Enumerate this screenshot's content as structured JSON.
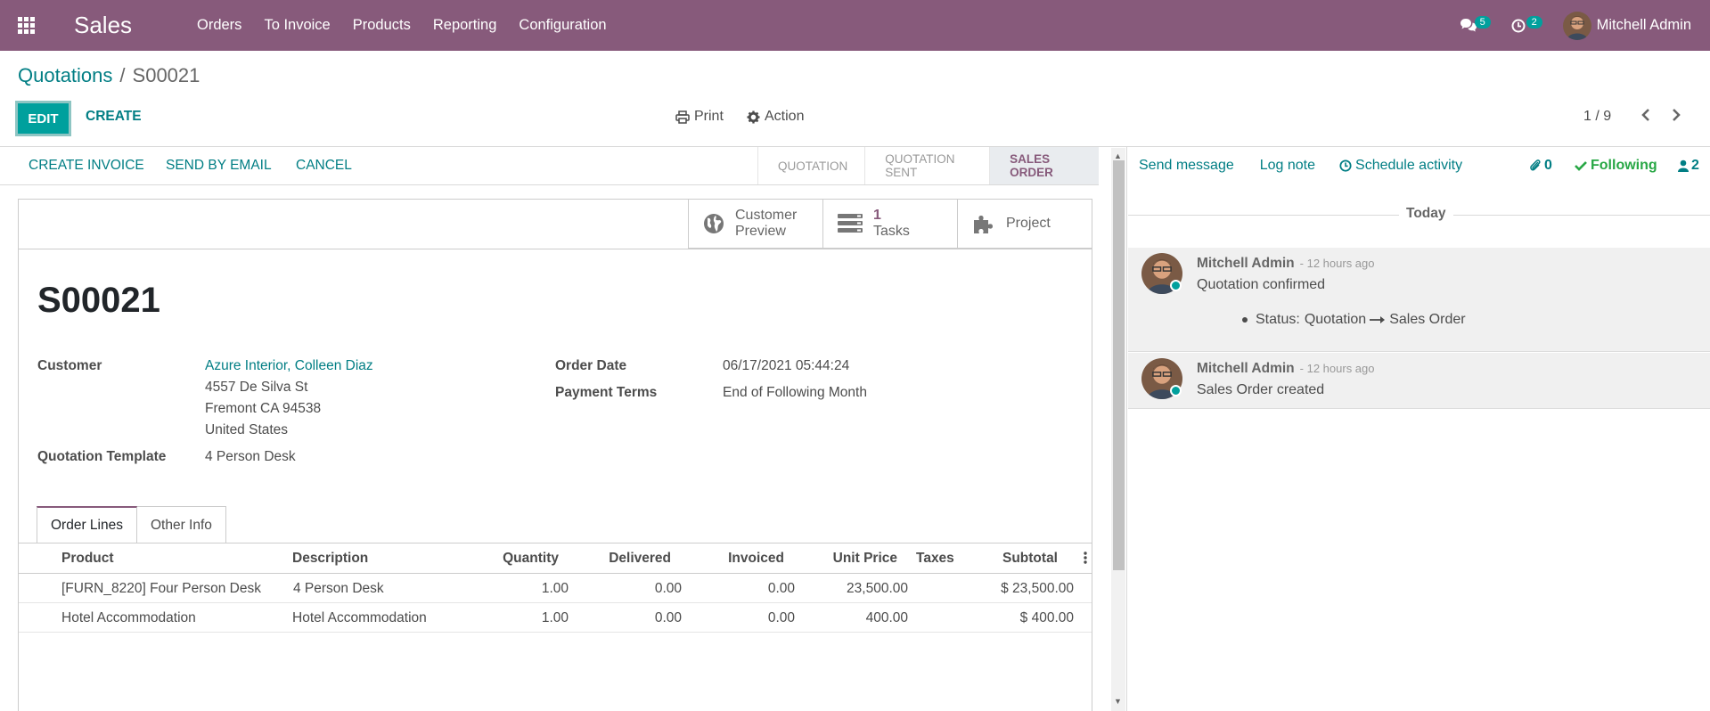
{
  "navbar": {
    "app_title": "Sales",
    "menu": [
      "Orders",
      "To Invoice",
      "Products",
      "Reporting",
      "Configuration"
    ],
    "messages_count": "5",
    "activities_count": "2",
    "user_name": "Mitchell Admin"
  },
  "breadcrumb": {
    "parent": "Quotations",
    "separator": "/",
    "current": "S00021"
  },
  "control_panel": {
    "edit_label": "EDIT",
    "create_label": "CREATE",
    "print_label": "Print",
    "action_label": "Action",
    "pager": "1 / 9"
  },
  "statusbar": {
    "buttons": [
      "CREATE INVOICE",
      "SEND BY EMAIL",
      "CANCEL"
    ],
    "stages": [
      "QUOTATION",
      "QUOTATION SENT",
      "SALES ORDER"
    ],
    "active_stage": "SALES ORDER"
  },
  "smart_buttons": {
    "preview_line1": "Customer",
    "preview_line2": "Preview",
    "tasks_count": "1",
    "tasks_label": "Tasks",
    "project_label": "Project"
  },
  "record": {
    "name": "S00021",
    "customer_label": "Customer",
    "customer_name": "Azure Interior, Colleen Diaz",
    "address_line1": "4557 De Silva St",
    "address_line2": "Fremont CA 94538",
    "address_line3": "United States",
    "template_label": "Quotation Template",
    "template_value": "4 Person Desk",
    "order_date_label": "Order Date",
    "order_date_value": "06/17/2021 05:44:24",
    "payment_terms_label": "Payment Terms",
    "payment_terms_value": "End of Following Month"
  },
  "tabs": [
    "Order Lines",
    "Other Info"
  ],
  "order_lines": {
    "columns": [
      "Product",
      "Description",
      "Quantity",
      "Delivered",
      "Invoiced",
      "Unit Price",
      "Taxes",
      "Subtotal"
    ],
    "rows": [
      {
        "product": "[FURN_8220] Four Person Desk",
        "description": "4 Person Desk",
        "quantity": "1.00",
        "delivered": "0.00",
        "invoiced": "0.00",
        "unit_price": "23,500.00",
        "taxes": "",
        "subtotal": "$ 23,500.00"
      },
      {
        "product": "Hotel Accommodation",
        "description": "Hotel Accommodation",
        "quantity": "1.00",
        "delivered": "0.00",
        "invoiced": "0.00",
        "unit_price": "400.00",
        "taxes": "",
        "subtotal": "$ 400.00"
      }
    ]
  },
  "chatter": {
    "send_message": "Send message",
    "log_note": "Log note",
    "schedule_activity": "Schedule activity",
    "attachments_count": "0",
    "following_label": "Following",
    "followers_count": "2",
    "day_label": "Today",
    "messages": [
      {
        "author": "Mitchell Admin",
        "date": "- 12 hours ago",
        "body": "Quotation confirmed",
        "tracking_field": "Status:",
        "tracking_old": "Quotation",
        "tracking_new": "Sales Order"
      },
      {
        "author": "Mitchell Admin",
        "date": "- 12 hours ago",
        "body": "Sales Order created"
      }
    ]
  },
  "colors": {
    "brand": "#875a7b",
    "accent": "#00a09d",
    "link": "#017e84",
    "following": "#28a745"
  }
}
